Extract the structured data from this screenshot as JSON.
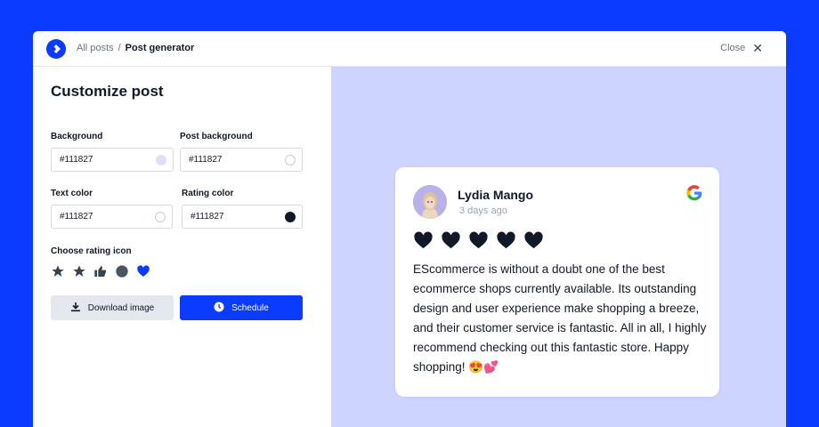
{
  "breadcrumb": {
    "parent": "All posts",
    "separator": "/",
    "current": "Post generator"
  },
  "close_label": "Close",
  "panel": {
    "title": "Customize post",
    "background": {
      "label": "Background",
      "value": "#111827",
      "swatch": "#e5dcf7"
    },
    "post_background": {
      "label": "Post background",
      "value": "#111827",
      "swatch": "#ffffff"
    },
    "text_color": {
      "label": "Text color",
      "value": "#111827",
      "swatch": "#ffffff"
    },
    "rating_color": {
      "label": "Rating color",
      "value": "#111827",
      "swatch": "#111827"
    },
    "rating_icon_label": "Choose rating icon",
    "rating_icons": [
      "star-icon",
      "star-outline-icon",
      "thumbs-up-icon",
      "circle-icon",
      "heart-icon"
    ],
    "download_label": "Download image",
    "schedule_label": "Schedule"
  },
  "review_card": {
    "name": "Lydia Mango",
    "date": "3 days ago",
    "rating": 5,
    "text": "EScommerce is without a doubt one of the best ecommerce shops currently available. Its outstanding design and user experience make shopping a breeze, and their customer service is fantastic. All in all, I highly recommend checking out this fantastic store. Happy shopping! 😍💕"
  },
  "colors": {
    "brand": "#0a3bff",
    "preview_bg": "#cdd5ff",
    "text": "#111827"
  }
}
